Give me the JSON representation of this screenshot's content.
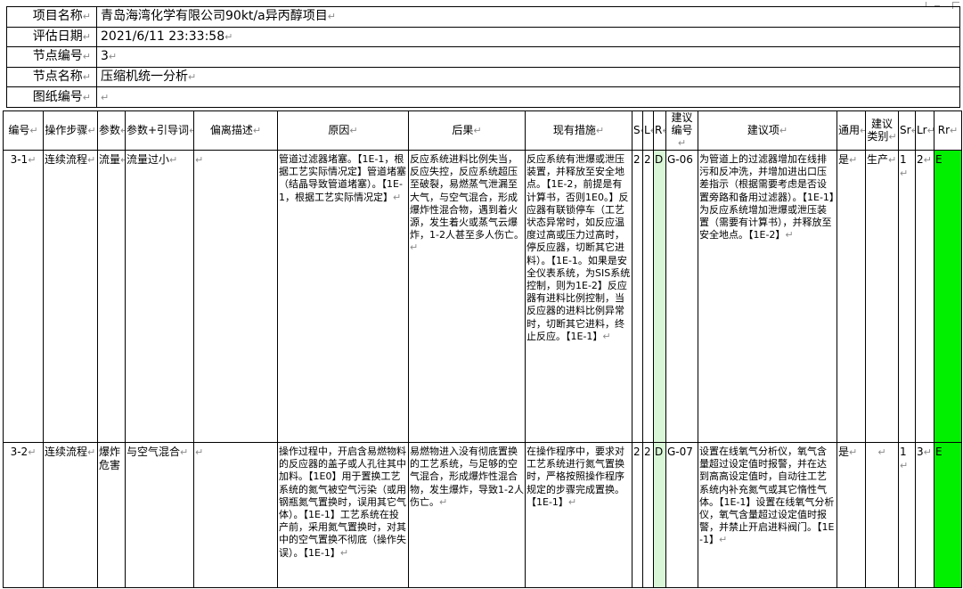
{
  "marker": "↵",
  "info": [
    {
      "label": "项目名称",
      "value": "青岛海湾化学有限公司90kt/a异丙醇项目"
    },
    {
      "label": "评估日期",
      "value": "2021/6/11 23:33:58"
    },
    {
      "label": "节点编号",
      "value": "3"
    },
    {
      "label": "节点名称",
      "value": "压缩机统一分析"
    },
    {
      "label": "图纸编号",
      "value": ""
    }
  ],
  "columns": [
    "编号",
    "操作步骤",
    "参数",
    "参数+引导词",
    "偏离描述",
    "原因",
    "后果",
    "现有措施",
    "S",
    "L",
    "R",
    "建议编号",
    "建议项",
    "通用",
    "建议类别",
    "Sr",
    "Lr",
    "Rr"
  ],
  "rows": [
    {
      "id": "3-1",
      "step": "连续流程",
      "param": "流量",
      "param_guide": "流量过小",
      "deviation": "",
      "cause": "管道过滤器堵塞。【1E-1，根据工艺实际情况定】管道堵塞（结晶导致管道堵塞）。【1E-1，根据工艺实际情况定】",
      "consequence": "反应系统进料比例失当，反应失控，反应系统超压至破裂，易燃蒸气泄漏至大气，与空气混合，形成爆炸性混合物，遇到着火源，发生着火或蒸气云爆炸，1-2人甚至多人伤亡。",
      "measures": "反应系统有泄爆或泄压装置，并释放至安全地点。【1E-2，前提是有计算书，否则1E0。】反应器有联锁停车（工艺状态异常时，如反应温度过高或压力过高时，停反应器，切断其它进料）。【1E-1。如果是安全仪表系统，为SIS系统控制，则为1E-2】反应器有进料比例控制，当反应器的进料比例异常时，切断其它进料，终止反应。【1E-1】",
      "s": "2",
      "l": "2",
      "r": "D",
      "rec_id": "G-06",
      "recommendation": "为管道上的过滤器增加在线排污和反冲洗，并增加进出口压差指示（根据需要考虑是否设置旁路和备用过滤器）。【1E-1】为反应系统增加泄爆或泄压装置（需要有计算书），并释放至安全地点。【1E-2】",
      "general": "是",
      "category": "生产",
      "sr": "1",
      "lr": "2",
      "rr": "E"
    },
    {
      "id": "3-2",
      "step": "连续流程",
      "param": "爆炸危害",
      "param_guide": "与空气混合",
      "deviation": "",
      "cause": "操作过程中，开启含易燃物料的反应器的盖子或人孔往其中加料。【1E0】用于置换工艺系统的氮气被空气污染（或用钢瓶氮气置换时，误用其它气体）。【1E-1】工艺系统在投产前，采用氮气置换时，对其中的空气置换不彻底（操作失误）。【1E-1】",
      "consequence": "易燃物进入没有彻底置换的工艺系统，与足够的空气混合，形成爆炸性混合物，发生爆炸，导致1-2人伤亡。",
      "measures": "在操作程序中，要求对工艺系统进行氮气置换时，严格按照操作程序规定的步骤完成置换。【1E-1】",
      "s": "2",
      "l": "2",
      "r": "D",
      "rec_id": "G-07",
      "recommendation": "设置在线氧气分析仪，氧气含量超过设定值时报警，并在达到高高设定值时，自动往工艺系统内补充氮气或其它惰性气体。【1E-1】设置在线氧气分析仪，氧气含量超过设定值时报警，并禁止开启进料阀门。【1E-1】",
      "general": "是",
      "category": "",
      "sr": "1",
      "lr": "3",
      "rr": "E"
    }
  ]
}
